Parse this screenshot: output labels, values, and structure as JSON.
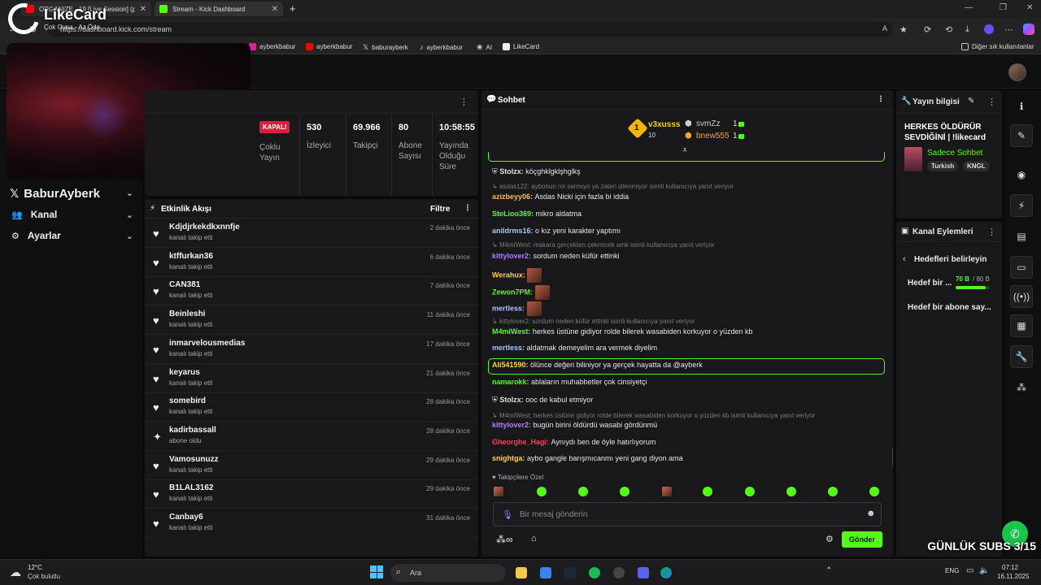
{
  "browser": {
    "tabs": [
      {
        "title": "ORGANIZE - 19 [Live Session] (pr",
        "active": false
      },
      {
        "title": "Stream - Kick Dashboard",
        "active": true
      }
    ],
    "new_tab_label": "+",
    "url": "https://dashboard.kick.com/stream",
    "bookmarks": [
      "ayberkbabur",
      "ayberkbabur",
      "baburayberk",
      "ayberkbabur",
      "AI",
      "LikeCard"
    ],
    "other_bookmarks": "Diğer sık kullanılanlar"
  },
  "overlay": {
    "brand": "LikeCard",
    "brand_sub": "Çok Oyna - Az Öde",
    "streamer_handle": "BaburAyberk",
    "subs_counter": "GÜNLÜK SUBS 3/15"
  },
  "sidebar": {
    "items": [
      {
        "label": "Kanal",
        "icon": "users-icon"
      },
      {
        "label": "Ayarlar",
        "icon": "gear-icon"
      }
    ]
  },
  "stats": {
    "status": "KAPALI",
    "mode_label": "Çoklu Yayın",
    "items": [
      {
        "value": "530",
        "label": "İzleyici"
      },
      {
        "value": "69.966",
        "label": "Takipçi"
      },
      {
        "value": "80",
        "label": "Abone Sayısı"
      },
      {
        "value": "10:58:55",
        "label": "Yayında Olduğu Süre"
      }
    ]
  },
  "activity": {
    "title": "Etkinlik Akışı",
    "filter_label": "Filtre",
    "items": [
      {
        "name": "Kdjdjrkekdkxnnfje",
        "action": "kanalı takip etti",
        "time": "2 dakika önce",
        "type": "follow"
      },
      {
        "name": "ktffurkan36",
        "action": "kanalı takip etti",
        "time": "6 dakika önce",
        "type": "follow"
      },
      {
        "name": "CAN381",
        "action": "kanalı takip etti",
        "time": "7 dakika önce",
        "type": "follow"
      },
      {
        "name": "Beinleshi",
        "action": "kanalı takip etti",
        "time": "11 dakika önce",
        "type": "follow"
      },
      {
        "name": "inmarvelousmedias",
        "action": "kanalı takip etti",
        "time": "17 dakika önce",
        "type": "follow"
      },
      {
        "name": "keyarus",
        "action": "kanalı takip etti",
        "time": "21 dakika önce",
        "type": "follow"
      },
      {
        "name": "somebird",
        "action": "kanalı takip etti",
        "time": "28 dakika önce",
        "type": "follow"
      },
      {
        "name": "kadirbassall",
        "action": "abone oldu",
        "time": "28 dakika önce",
        "type": "sub"
      },
      {
        "name": "Vamosunuzz",
        "action": "kanalı takip etti",
        "time": "29 dakika önce",
        "type": "follow"
      },
      {
        "name": "B1LAL3162",
        "action": "kanalı takip etti",
        "time": "29 dakika önce",
        "type": "follow"
      },
      {
        "name": "Canbay6",
        "action": "kanalı takip etti",
        "time": "31 dakika önce",
        "type": "follow"
      }
    ]
  },
  "chat": {
    "title": "Sohbet",
    "leaderboard": {
      "first": {
        "name": "v3xusss",
        "count": "10"
      },
      "others": [
        {
          "name": "svmZz",
          "count": "1",
          "color": "#cfcfcf"
        },
        {
          "name": "bnew555",
          "count": "1",
          "color": "#f5a623"
        }
      ]
    },
    "messages": [
      {
        "type": "msg",
        "user": "Stolzx",
        "color": "#e0e0e0",
        "text": "köçghklgklşhglkş",
        "mod": true
      },
      {
        "type": "reply",
        "text": "asdas122: aybonun rol sarmıyo ya zaten izlenmiyor isimli kullanıcıya yanıt veriyor"
      },
      {
        "type": "msg",
        "user": "azizbeyy06",
        "color": "#ffb84d",
        "text": "Asdas Nicki için fazla bi iddia"
      },
      {
        "type": "msg",
        "user": "SteLioo369",
        "color": "#53fc18",
        "text": "mikro aldatma"
      },
      {
        "type": "msg",
        "user": "anildrms16",
        "color": "#9ecbff",
        "text": "o kız yeni karakter yaptımı"
      },
      {
        "type": "reply",
        "text": "M4miWest: makara gerçekten çekmicek amk isimli kullanıcıya yanıt veriyor"
      },
      {
        "type": "msg",
        "user": "kittylover2",
        "color": "#b57cff",
        "text": "sordum neden küfür ettinki"
      },
      {
        "type": "emote",
        "user": "Werahux",
        "color": "#ffd24d"
      },
      {
        "type": "emote",
        "user": "Zewon7PM",
        "color": "#53fc18"
      },
      {
        "type": "emote",
        "user": "mertless",
        "color": "#9ecbff"
      },
      {
        "type": "reply",
        "text": "kittylover2: sordum neden küfür ettinki isimli kullanıcıya yanıt veriyor"
      },
      {
        "type": "msg",
        "user": "M4miWest",
        "color": "#53fc18",
        "text": "herkes üstüne gidiyor rolde bilerek wasabiden korkuyor o yüzden kb"
      },
      {
        "type": "msg",
        "user": "mertless",
        "color": "#9ecbff",
        "text": "aldatmak demeyelim ara vermek diyelim"
      },
      {
        "type": "msg",
        "user": "Ali541590",
        "color": "#ffd24d",
        "text": "ölünce değeri biliniyor ya gerçek hayatta da @ayberk",
        "highlight": true
      },
      {
        "type": "msg",
        "user": "namarokk",
        "color": "#53fc18",
        "text": "ablaların muhabbetler çok cinsiyetçi"
      },
      {
        "type": "msg",
        "user": "Stolzx",
        "color": "#e0e0e0",
        "text": "ooc de kabul etmiyor",
        "mod": true
      },
      {
        "type": "reply",
        "text": "M4miWest: herkes üstüne gidiyor rolde bilerek wasabiden korkuyor o yüzden kb isimli kullanıcıya yanıt veriyor"
      },
      {
        "type": "msg",
        "user": "kittylover2",
        "color": "#b57cff",
        "text": "bugün birini öldürdü wasabi gördünmü"
      },
      {
        "type": "msg",
        "user": "Gheorghe_Hagi",
        "color": "#ff3b5c",
        "text": "Aynıydı ben de öyle hatırlıyorum"
      },
      {
        "type": "msg",
        "user": "snightga",
        "color": "#ffd24d",
        "text": "aybo gangle barışmıcanmı yeni gang diyon ama"
      }
    ],
    "follower_only_label": "Takipçilere Özel",
    "input_placeholder": "Bir mesaj gönderin",
    "send_label": "Gönder"
  },
  "stream_info": {
    "title": "Yayın bilgisi",
    "stream_title": "HERKES ÖLDÜRÜR SEVDİĞİNİ | !likecard",
    "category": "Sadece Sohbet",
    "tags": [
      "Turkish",
      "KNGL"
    ]
  },
  "channel_actions": {
    "title": "Kanal Eylemleri",
    "goals_title": "Hedefleri belirleyin",
    "goal1_label": "Hedef bir ...",
    "goal1_progress": "70 B",
    "goal1_total": "/ 80 B",
    "goal1_fraction": 0.875,
    "goal2_label": "Hedef bir abone say..."
  },
  "taskbar": {
    "weather_temp": "12°C",
    "weather_desc": "Çok bulutlu",
    "search_placeholder": "Ara",
    "lang": "ENG",
    "time": "07:12",
    "date": "16.11.2025"
  },
  "colors": {
    "kick_green": "#53fc18",
    "live_red": "#e01c3c",
    "panel_bg": "#18181a"
  }
}
